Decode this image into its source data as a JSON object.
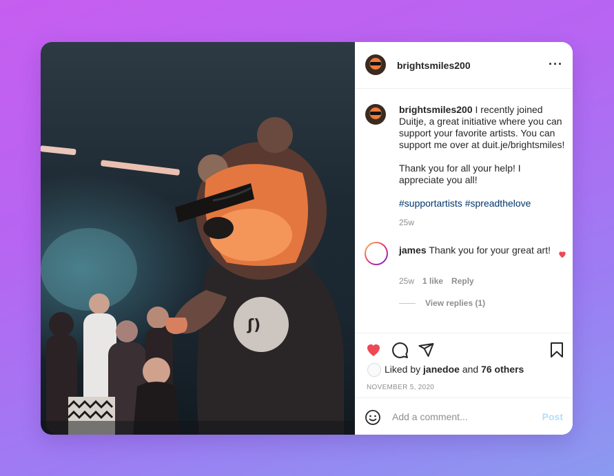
{
  "post": {
    "username": "brightsmiles200",
    "caption_line1": "I recently joined Duitje, a great initiative where you can support your favorite artists. You can support me over at duit.je/brightsmiles!",
    "caption_line2": "Thank you for all your help! I appreciate you all!",
    "hashtags": "#supportartists #spreadthelove",
    "caption_age": "25w",
    "liked_by_prefix": "Liked by",
    "liked_by_user": "janedoe",
    "liked_by_and": "and",
    "liked_by_others": "76 others",
    "date": "NOVEMBER 5, 2020"
  },
  "comment": {
    "username": "james",
    "text": "Thank you for your great art!",
    "age": "25w",
    "likes": "1 like",
    "reply_label": "Reply",
    "view_replies": "View replies (1)"
  },
  "composer": {
    "placeholder": "Add a comment...",
    "post_label": "Post"
  },
  "icons": {
    "more": "more-options-icon",
    "like": "heart-icon",
    "comment": "comment-icon",
    "share": "send-icon",
    "save": "bookmark-icon",
    "emoji": "emoji-icon"
  },
  "colors": {
    "heart": "#ed4956",
    "hashtag": "#00376b",
    "post_button": "#b2dffc"
  }
}
